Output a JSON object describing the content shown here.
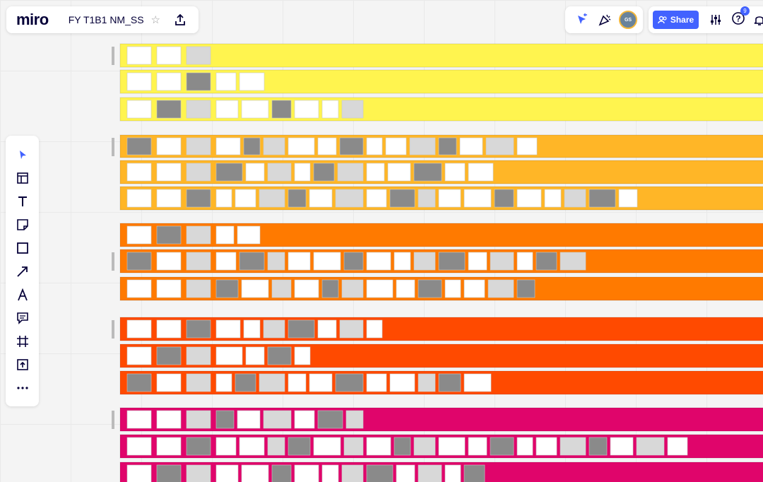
{
  "app": {
    "logo": "miro",
    "board_title": "FY T1B1 NM_SS"
  },
  "header": {
    "share_label": "Share",
    "avatar_initials": "GS",
    "help_badge": "9",
    "accent": "#4262ff"
  },
  "toolbar": {
    "tools": [
      {
        "name": "select-tool",
        "icon": "cursor-icon"
      },
      {
        "name": "templates-tool",
        "icon": "templates-icon"
      },
      {
        "name": "text-tool",
        "icon": "text-icon"
      },
      {
        "name": "sticky-note-tool",
        "icon": "sticky-note-icon"
      },
      {
        "name": "shape-tool",
        "icon": "square-icon"
      },
      {
        "name": "arrow-tool",
        "icon": "arrow-icon"
      },
      {
        "name": "pen-tool",
        "icon": "pen-icon"
      },
      {
        "name": "comment-tool",
        "icon": "comment-icon"
      },
      {
        "name": "frame-tool",
        "icon": "frame-icon"
      },
      {
        "name": "upload-tool",
        "icon": "upload-icon"
      },
      {
        "name": "more-tool",
        "icon": "more-icon"
      }
    ]
  },
  "board": {
    "row_colors": [
      "#fff44f",
      "#ffb627",
      "#ff7a00",
      "#ff4a00",
      "#e0056b"
    ]
  }
}
